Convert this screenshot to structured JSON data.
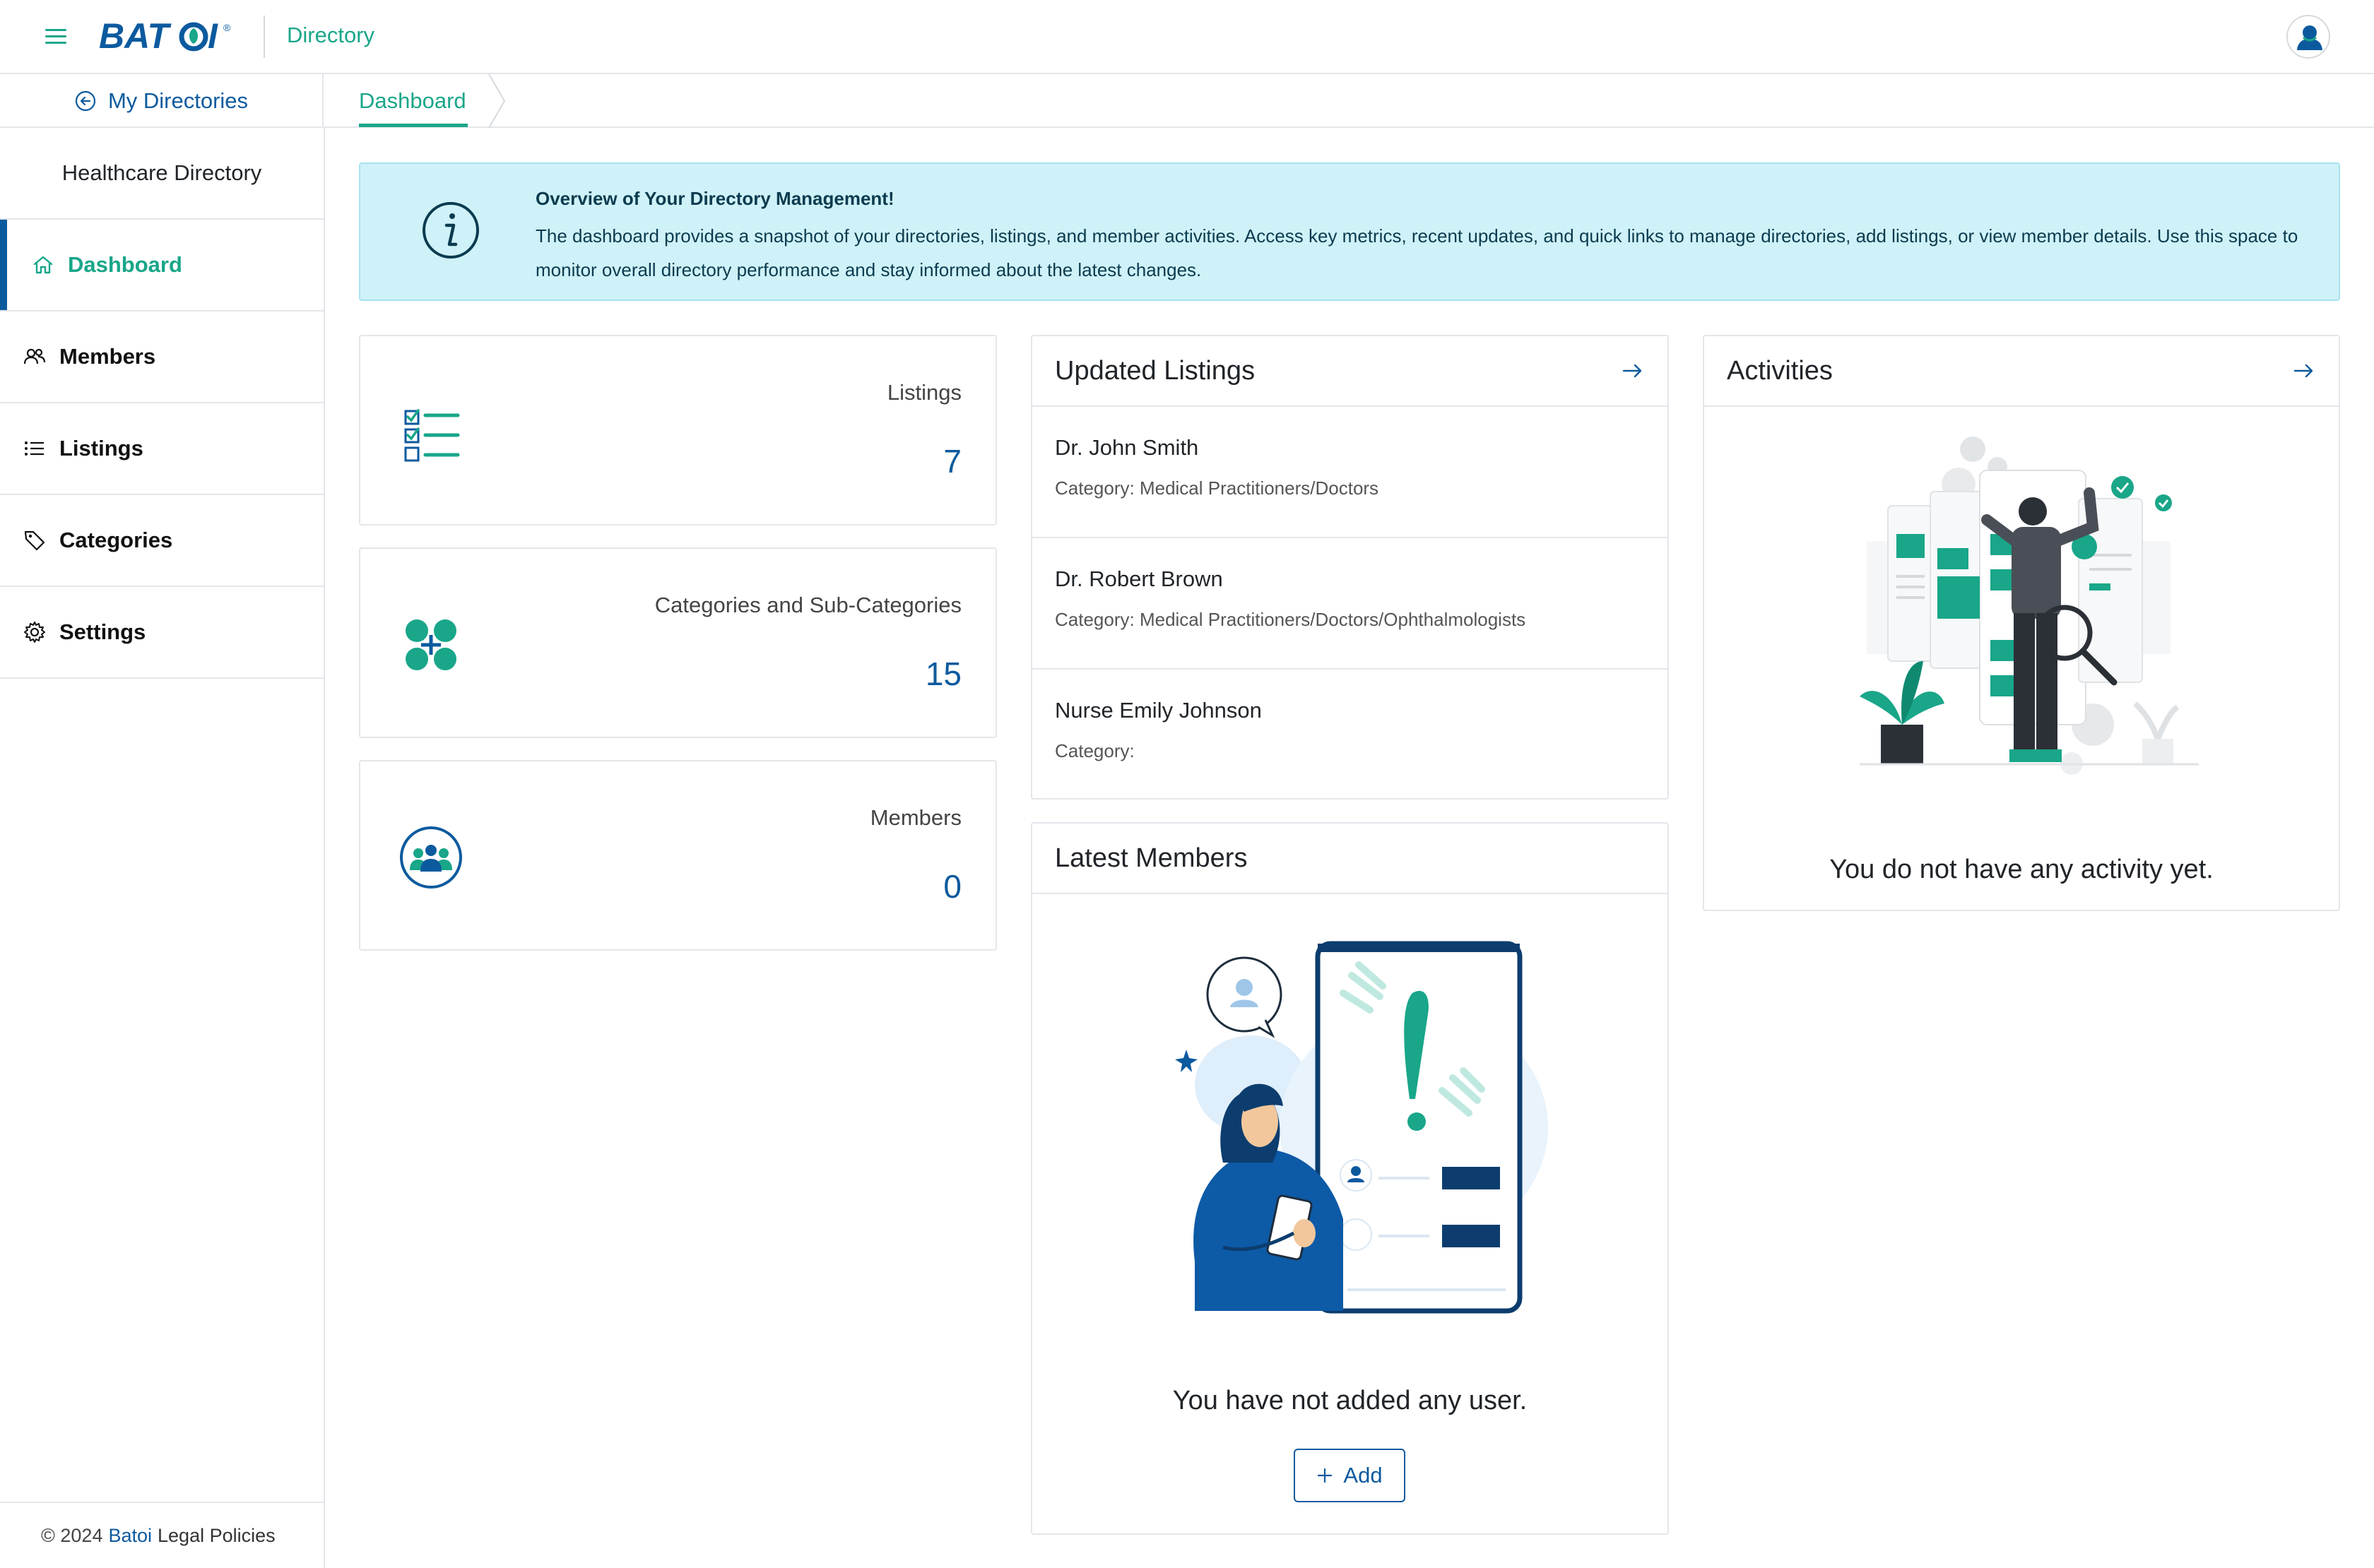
{
  "header": {
    "logo_text": "BATOI",
    "app_title": "Directory",
    "menu_icon": "hamburger-icon",
    "avatar_icon": "user-avatar-icon"
  },
  "subheader": {
    "back_label": "My Directories",
    "breadcrumb": "Dashboard"
  },
  "sidebar": {
    "directory_name": "Healthcare Directory",
    "items": [
      {
        "label": "Dashboard",
        "icon": "home-icon",
        "active": true
      },
      {
        "label": "Members",
        "icon": "users-icon",
        "active": false
      },
      {
        "label": "Listings",
        "icon": "list-icon",
        "active": false
      },
      {
        "label": "Categories",
        "icon": "tag-icon",
        "active": false
      },
      {
        "label": "Settings",
        "icon": "gear-icon",
        "active": false
      }
    ],
    "footer": {
      "copyright": "© 2024",
      "brand": "Batoi",
      "link": "Legal Policies"
    }
  },
  "banner": {
    "title": "Overview of Your Directory Management!",
    "text": "The dashboard provides a snapshot of your directories, listings, and member activities. Access key metrics, recent updates, and quick links to manage directories, add listings, or view member details. Use this space to monitor overall directory performance and stay informed about the latest changes."
  },
  "stats": [
    {
      "label": "Listings",
      "value": "7",
      "icon": "checklist-icon"
    },
    {
      "label": "Categories and Sub-Categories",
      "value": "15",
      "icon": "categories-plus-icon"
    },
    {
      "label": "Members",
      "value": "0",
      "icon": "group-icon"
    }
  ],
  "updated_listings": {
    "title": "Updated Listings",
    "items": [
      {
        "name": "Dr. John Smith",
        "category": "Category: Medical Practitioners/Doctors"
      },
      {
        "name": "Dr. Robert Brown",
        "category": "Category: Medical Practitioners/Doctors/Ophthalmologists"
      },
      {
        "name": "Nurse Emily Johnson",
        "category": "Category:"
      }
    ]
  },
  "latest_members": {
    "title": "Latest Members",
    "empty_text": "You have not added any user.",
    "add_label": "Add"
  },
  "activities": {
    "title": "Activities",
    "empty_text": "You do not have any activity yet."
  },
  "colors": {
    "brand_blue": "#0c5a9e",
    "brand_green": "#19a689",
    "banner_bg": "#cff2f8",
    "border": "#e3e6ea"
  }
}
